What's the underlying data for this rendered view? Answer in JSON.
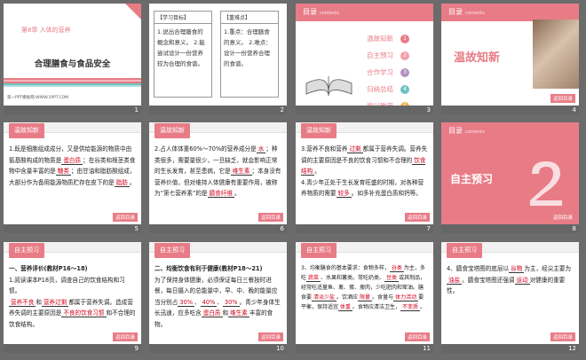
{
  "slides": {
    "s1": {
      "num": "1",
      "chapter": "第8章 人体的营养",
      "title": "合理膳食与食品安全",
      "footer": "第一PPT模板网-WWW.1PPT.COM"
    },
    "s2": {
      "num": "2",
      "goals_head": "【学习目标】",
      "goals_body": "1.说出合理膳食的概念和意义。 2.能尝试设计一份营养较为合理的食谱。",
      "key_head": "【重难点】",
      "key_body": "1.重点：合理膳食的意义。 2.难点：设计一份营养合理的食谱。"
    },
    "s3": {
      "num": "3",
      "head": "目录",
      "head_en": "contents",
      "items": [
        "温故知新",
        "自主预习",
        "合作学习",
        "归纳总结",
        "学以致用"
      ],
      "nums": [
        "1",
        "2",
        "3",
        "4",
        "5"
      ]
    },
    "s4": {
      "num": "4",
      "head": "目录",
      "head_en": "contents",
      "title": "温故知新",
      "back": "返回目录"
    },
    "s5": {
      "num": "5",
      "tab": "温故知新",
      "back": "返回目录",
      "t1": "1.既是细胞组成成分，又是供给能源的物质中由氨基酸构成的物质是",
      "a1": "蛋白质",
      "t2": "；在谷类和根茎类食物中含量丰富的是",
      "a2": "糖类",
      "t3": "；由甘油和脂肪酸组成，大部分作为备用能源物质贮存在皮下的是",
      "a3": "脂肪",
      "t4": "。"
    },
    "s6": {
      "num": "6",
      "tab": "温故知新",
      "back": "返回目录",
      "t1": "2.占人体体重60%～70%的营养成分是",
      "a1": "水",
      "t2": "；种类很多，需要量很少，一旦缺乏，就会影响正常的生长发育，甚至患病，它是",
      "a2": "维生素",
      "t3": "；本身没有营养价值，但对维持人体健康有重要作用，被称为“第七营养素”的是",
      "a3": "膳食纤维",
      "t4": "。"
    },
    "s7": {
      "num": "7",
      "tab": "温故知新",
      "back": "返回目录",
      "t1": "3.营养不良和营养",
      "a1": "过剩",
      "t2": "都属于营养失调。营养失调的主要原因是不良的饮食习惯和不合理的",
      "a2": "饮食结构",
      "t3": "。",
      "t4": "4.青少年正处于生长发育旺盛的时期，对各种营养物质的需要",
      "a3": "较多",
      "t5": "。如多补充蛋白质和钙等。"
    },
    "s8": {
      "num": "8",
      "head": "目录",
      "head_en": "contents",
      "title": "自主预习",
      "back": "返回目录"
    },
    "s9": {
      "num": "9",
      "tab": "自主预习",
      "back": "返回目录",
      "sub": "一、营养评价(教材P16～18)",
      "t1": "1.阅读课本P18页，调查自己的饮食结构和习惯。",
      "a1": "营养不良",
      "t2": "和",
      "a2": "营养过剩",
      "t3": "都属于营养失调。造成营养失调的主要原因是",
      "a3": "不良的饮食习惯",
      "t4": "和不合理的饮食结构。"
    },
    "s10": {
      "num": "10",
      "tab": "自主预习",
      "back": "返回目录",
      "sub": "二、均衡饮食有利于健康(教材P18～21)",
      "t1": "为了保持身体健康，必须保证每日三餐按时进餐，每日摄入的总能量中，早、中、晚的能量应当分别占",
      "a1": "30%",
      "a2": "40%",
      "a3": "30%",
      "t2": "。青少年身体生长迅速，应多吃含",
      "a4": "蛋白质",
      "t3": "和",
      "a5": "维生素",
      "t4": "丰富的食物。"
    },
    "s11": {
      "num": "11",
      "tab": "自主预习",
      "back": "返回目录",
      "t1": "3、均衡膳食的基本要求：食物多样，",
      "a1": "谷类",
      "t2": "为主，多吃",
      "a2": "蔬菜",
      "t3": "、水果和薯类。常吃奶类、",
      "a3": "豆类",
      "t4": "或其制品，经常吃适量鱼、禽、蛋、瘦肉，少吃肥肉和荤油。膳食要",
      "a4": "清淡少盐",
      "t5": "。饮酒应",
      "a5": "限量",
      "t6": "。食量与",
      "a6": "体力活动",
      "t7": "要平衡，保持适宜",
      "a7": "体重",
      "t8": "。食物应清洁卫生，",
      "a8": "不变质",
      "t9": "。"
    },
    "s12": {
      "num": "12",
      "tab": "自主预习",
      "back": "返回目录",
      "t1": "4、膳食宝塔图的底层以",
      "a1": "谷物",
      "t2": "为主，经尖主要为",
      "a2": "油盐",
      "t3": "。膳食宝塔图还强调",
      "a3": "运动",
      "t4": "对健康的重要性。"
    }
  },
  "colors": {
    "accent": "#e87c86",
    "answer": "#d0021b"
  }
}
